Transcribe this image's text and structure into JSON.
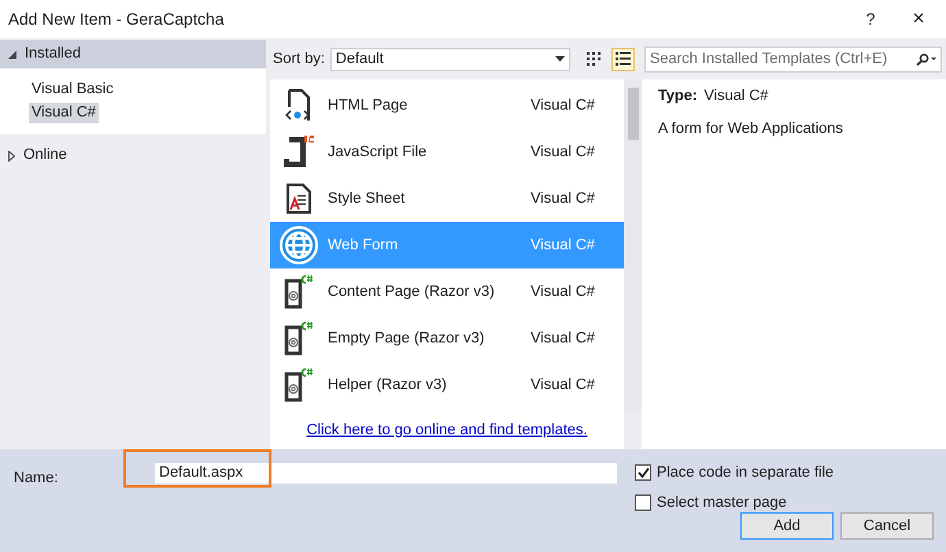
{
  "window": {
    "title": "Add New Item - GeraCaptcha",
    "help": "?",
    "close": "×"
  },
  "sidebar": {
    "items": [
      {
        "label": "Installed",
        "expanded": true,
        "children": [
          {
            "label": "Visual Basic",
            "selected": false
          },
          {
            "label": "Visual C#",
            "selected": true
          }
        ]
      },
      {
        "label": "Online",
        "expanded": false
      }
    ]
  },
  "sort": {
    "label": "Sort by:",
    "value": "Default"
  },
  "views": [
    {
      "kind": "grid",
      "selected": false
    },
    {
      "kind": "list",
      "selected": true
    }
  ],
  "search": {
    "placeholder": "Search Installed Templates (Ctrl+E)"
  },
  "templates": [
    {
      "kind": "html",
      "name": "HTML Page",
      "language": "Visual C#",
      "selected": false
    },
    {
      "kind": "js",
      "name": "JavaScript File",
      "language": "Visual C#",
      "selected": false
    },
    {
      "kind": "css",
      "name": "Style Sheet",
      "language": "Visual C#",
      "selected": false
    },
    {
      "kind": "web",
      "name": "Web Form",
      "language": "Visual C#",
      "selected": true
    },
    {
      "kind": "razor",
      "name": "Content Page (Razor v3)",
      "language": "Visual C#",
      "selected": false
    },
    {
      "kind": "razor",
      "name": "Empty Page (Razor v3)",
      "language": "Visual C#",
      "selected": false
    },
    {
      "kind": "razor",
      "name": "Helper (Razor v3)",
      "language": "Visual C#",
      "selected": false
    }
  ],
  "online_link": "Click here to go online and find templates.",
  "details": {
    "type_label": "Type:",
    "type_value": "Visual C#",
    "description": "A form for Web Applications"
  },
  "name_field": {
    "label": "Name:",
    "value": "Default.aspx",
    "highlighted": true
  },
  "options": [
    {
      "label": "Place code in separate file",
      "checked": true
    },
    {
      "label": "Select master page",
      "checked": false
    }
  ],
  "buttons": [
    {
      "label": "Add",
      "kind": "primary"
    },
    {
      "label": "Cancel",
      "kind": "secondary"
    }
  ]
}
